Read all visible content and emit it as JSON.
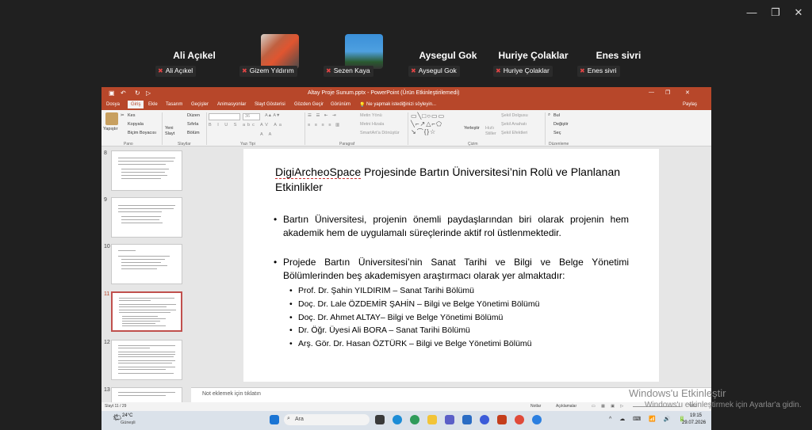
{
  "window_controls": {
    "minimize": "—",
    "restore": "❐",
    "close": "✕"
  },
  "participants": [
    {
      "name": "Ali Açıkel",
      "tag": "Ali Açıkel"
    },
    {
      "name": "",
      "tag": "Gizem Yıldırım"
    },
    {
      "name": "",
      "tag": "Sezen Kaya"
    },
    {
      "name": "Aysegul Gok",
      "tag": "Aysegul Gok"
    },
    {
      "name": "Huriye Çolaklar",
      "tag": "Huriye Çolaklar"
    },
    {
      "name": "Enes sivri",
      "tag": "Enes sivri"
    }
  ],
  "ppt": {
    "title": "Altay Proje Sunum.pptx - PowerPoint (Ürün Etkinleştirilemedi)",
    "tabs": [
      "Dosya",
      "Giriş",
      "Ekle",
      "Tasarım",
      "Geçişler",
      "Animasyonlar",
      "Slayt Gösterisi",
      "Gözden Geçir",
      "Görünüm"
    ],
    "tell_me": "Ne yapmak istediğinizi söyleyin...",
    "share": "Paylaş",
    "ribbon": {
      "paste": "Yapıştır",
      "cut": "Kes",
      "copy": "Kopyala",
      "format_painter": "Biçim Boyacısı",
      "new_slide": "Yeni Slayt",
      "layout": "Düzen",
      "reset": "Sıfırla",
      "section": "Bölüm",
      "font_size": "36",
      "text_direction": "Metin Yönü",
      "align_text": "Metni Hizala",
      "smartart": "SmartArt'a Dönüştür",
      "arrange": "Yerleştir",
      "quick_styles": "Hızlı Stiller",
      "shape_fill": "Şekil Dolgusu",
      "shape_outline": "Şekil Anahatı",
      "shape_effects": "Şekil Efektleri",
      "find": "Bul",
      "replace": "Değiştir",
      "select": "Seç",
      "groups": [
        "Pano",
        "Slaytlar",
        "Yazı Tipi",
        "Paragraf",
        "Çizim",
        "Düzenleme"
      ]
    },
    "thumbs": [
      "8",
      "9",
      "10",
      "11",
      "12",
      "13"
    ],
    "slide": {
      "title_part1": "DigiArcheoSpace",
      "title_part2": " Projesinde Bartın Üniversitesi’nin Rolü ve Planlanan Etkinlikler",
      "bullet1": "Bartın Üniversitesi, projenin önemli paydaşlarından biri olarak projenin hem akademik hem de uygulamalı süreçlerinde aktif rol üstlenmektedir.",
      "bullet2": "Projede Bartın Üniversitesi’nin Sanat Tarihi ve Bilgi ve Belge Yönetimi Bölümlerinden beş akademisyen araştırmacı olarak yer almaktadır:",
      "sub": [
        "Prof. Dr. Şahin YILDIRIM – Sanat Tarihi Bölümü",
        "Doç. Dr. Lale ÖZDEMİR ŞAHİN – Bilgi ve Belge Yönetimi Bölümü",
        "Doç. Dr. Ahmet ALTAY– Bilgi ve Belge Yönetimi Bölümü",
        "Dr. Öğr. Üyesi Ali BORA – Sanat Tarihi Bölümü",
        "Arş. Gör. Dr. Hasan ÖZTÜRK – Bilgi ve Belge Yönetimi Bölümü"
      ]
    },
    "notes": "Not eklemek için tıklatın",
    "status": {
      "slide": "Slayt 11 / 29",
      "notes": "Notlar",
      "comments": "Açıklamalar",
      "zoom": "%62"
    },
    "taskbar": {
      "weather_temp": "24°C",
      "weather_desc": "Güneşli",
      "search": "Ara",
      "time": "19:15",
      "date": "29.07.2026"
    }
  },
  "watermark": {
    "line1": "Windows'u Etkinleştir",
    "line2": "Windows'u etkinleştirmek için Ayarlar'a gidin."
  }
}
